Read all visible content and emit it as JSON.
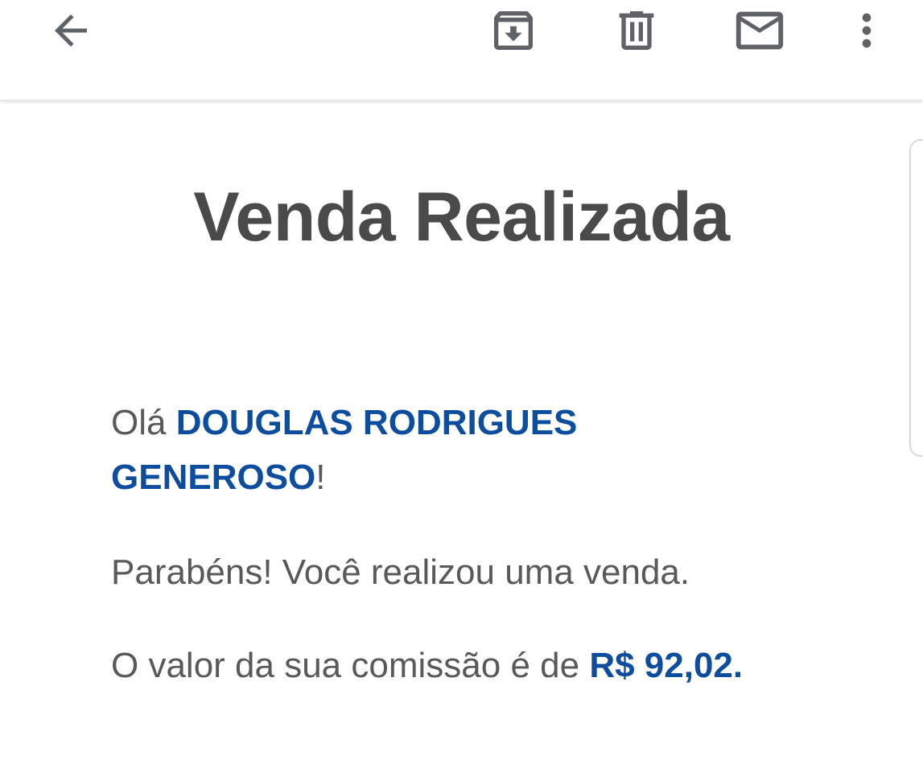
{
  "toolbar": {
    "back_icon": "arrow-left-icon",
    "archive_icon": "archive-icon",
    "delete_icon": "trash-icon",
    "mark_unread_icon": "mail-icon",
    "more_icon": "more-vert-icon"
  },
  "email": {
    "title": "Venda Realizada",
    "greeting_prefix": "Olá ",
    "recipient_name": "DOUGLAS RODRIGUES GENEROSO",
    "greeting_suffix": "!",
    "congrats_text": "Parabéns! Você realizou uma venda.",
    "commission_prefix": "O valor da sua comissão é de ",
    "commission_amount": "R$ 92,02."
  },
  "colors": {
    "title": "#4a4a4a",
    "body_text": "#595959",
    "highlight": "#0d4d9f",
    "icon": "#5f6368"
  }
}
